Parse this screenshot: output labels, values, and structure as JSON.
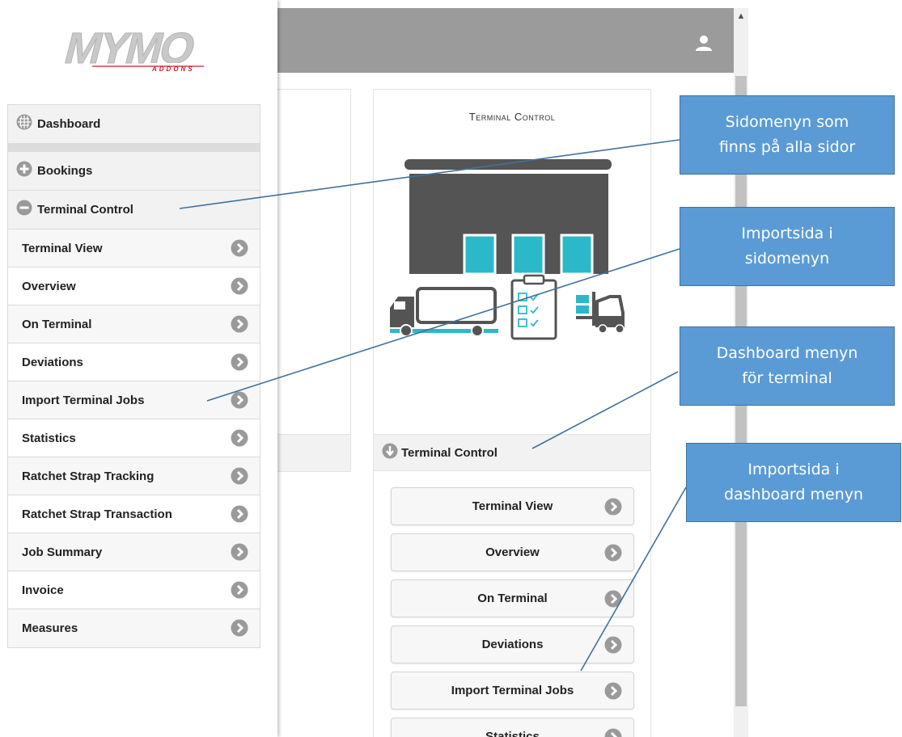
{
  "logo": {
    "brand": "MYMO",
    "tagline": "ADDONS"
  },
  "sidebar": {
    "main_items": [
      {
        "label": "Dashboard",
        "icon": "grid-globe-icon"
      },
      {
        "label": "Bookings",
        "icon": "plus-circle-icon"
      },
      {
        "label": "Terminal Control",
        "icon": "minus-circle-icon"
      }
    ],
    "sub_items": [
      {
        "label": "Terminal View"
      },
      {
        "label": "Overview"
      },
      {
        "label": "On Terminal"
      },
      {
        "label": "Deviations"
      },
      {
        "label": "Import Terminal Jobs"
      },
      {
        "label": "Statistics"
      },
      {
        "label": "Ratchet Strap Tracking"
      },
      {
        "label": "Ratchet Strap Transaction"
      },
      {
        "label": "Job Summary"
      },
      {
        "label": "Invoice"
      },
      {
        "label": "Measures"
      }
    ]
  },
  "header": {
    "user_icon": "user-icon"
  },
  "tile": {
    "title": "Terminal Control",
    "section_label": "Terminal Control",
    "section_icon": "arrow-down-circle-icon",
    "buttons": [
      {
        "label": "Terminal View"
      },
      {
        "label": "Overview"
      },
      {
        "label": "On Terminal"
      },
      {
        "label": "Deviations"
      },
      {
        "label": "Import Terminal Jobs"
      },
      {
        "label": "Statistics"
      }
    ]
  },
  "annotations": [
    {
      "line1": "Sidomenyn som",
      "line2": "finns på alla sidor"
    },
    {
      "line1": "Importsida i",
      "line2": "sidomenyn"
    },
    {
      "line1": "Dashboard menyn",
      "line2": "för terminal"
    },
    {
      "line1": "Importsida i",
      "line2": "dashboard menyn"
    }
  ],
  "colors": {
    "topbar": "#9b9b9b",
    "accent_teal": "#2bb9c9",
    "building": "#545454",
    "callout": "#5b9bd5",
    "chevron": "#9a9a9a"
  }
}
